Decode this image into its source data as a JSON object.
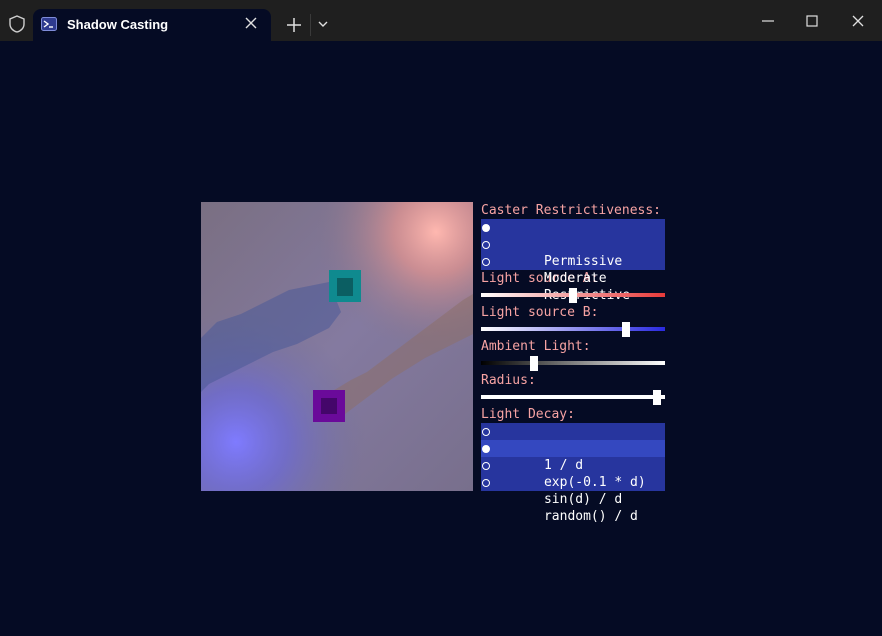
{
  "window": {
    "tab_title": "Shadow Casting",
    "icons": [
      "shield-icon",
      "terminal-icon",
      "close-icon",
      "plus-icon",
      "chevron-down-icon",
      "minimize-icon",
      "maximize-icon",
      "close-window-icon"
    ]
  },
  "panel": {
    "caster_label": "Caster Restrictiveness:",
    "caster_options": [
      {
        "label": "Permissive",
        "selected": true
      },
      {
        "label": "Moderate",
        "selected": false
      },
      {
        "label": "Restrictive",
        "selected": false
      }
    ],
    "light_a_label": "Light source A:",
    "light_a_value": 0.5,
    "light_b_label": "Light source B:",
    "light_b_value": 0.8,
    "ambient_label": "Ambient Light:",
    "ambient_value": 0.28,
    "radius_label": "Radius:",
    "radius_value": 0.98,
    "decay_label": "Light Decay:",
    "decay_options": [
      {
        "label": "1 / d",
        "selected": false
      },
      {
        "label": "exp(-0.1 * d)",
        "selected": true
      },
      {
        "label": "sin(d) / d",
        "selected": false
      },
      {
        "label": "random() / d",
        "selected": false
      }
    ]
  },
  "colors": {
    "background": "#050b24",
    "titlebar": "#1f1f1f",
    "label_text": "#f7a3a3",
    "option_bg": "#27359e",
    "option_selected_bg": "#3448c0",
    "light_a": "#e83a3a",
    "light_b": "#2a2ae0",
    "source_a_marker": "#0f8a8f",
    "source_b_marker": "#6a0a9a"
  }
}
